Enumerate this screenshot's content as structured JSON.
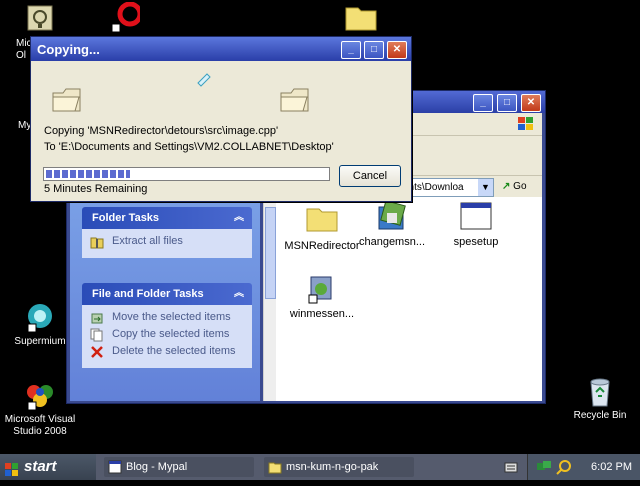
{
  "desktop": {
    "icons": [
      {
        "label": "Mic\nOl",
        "icon": "outlook-shortcut-icon"
      },
      {
        "label": "My",
        "icon": "my-documents-icon"
      },
      {
        "label": "Supermium",
        "icon": "supermium-browser-icon"
      },
      {
        "label": "Microsoft Visual Studio 2008",
        "icon": "visual-studio-icon"
      },
      {
        "label": "Recycle Bin",
        "icon": "recycle-bin-icon"
      }
    ]
  },
  "copy_dialog": {
    "title": "Copying...",
    "line_copying": "Copying 'MSNRedirector\\detours\\src\\image.cpp'",
    "line_to": "To 'E:\\Documents and Settings\\VM2.COLLABNET\\Desktop'",
    "progress_fraction": 0.3,
    "remaining": "5 Minutes Remaining",
    "cancel_label": "Cancel"
  },
  "explorer": {
    "address_text": "ents\\Downloa",
    "go_label": "Go",
    "folder_tasks": {
      "title": "Folder Tasks",
      "items": [
        "Extract all files"
      ]
    },
    "file_tasks": {
      "title": "File and Folder Tasks",
      "items": [
        "Move the selected items",
        "Copy the selected items",
        "Delete the selected items"
      ]
    },
    "files": [
      {
        "name": "MSNRedirector",
        "icon": "folder-icon"
      },
      {
        "name": "changemsn...",
        "icon": "installer-icon"
      },
      {
        "name": "spesetup",
        "icon": "window-exe-icon"
      },
      {
        "name": "winmessen...",
        "icon": "setup-package-icon"
      }
    ]
  },
  "taskbar": {
    "start_label": "start",
    "buttons": [
      {
        "label": "Blog - Mypal"
      },
      {
        "label": "msn-kum-n-go-pak"
      }
    ],
    "clock": "6:02 PM"
  }
}
